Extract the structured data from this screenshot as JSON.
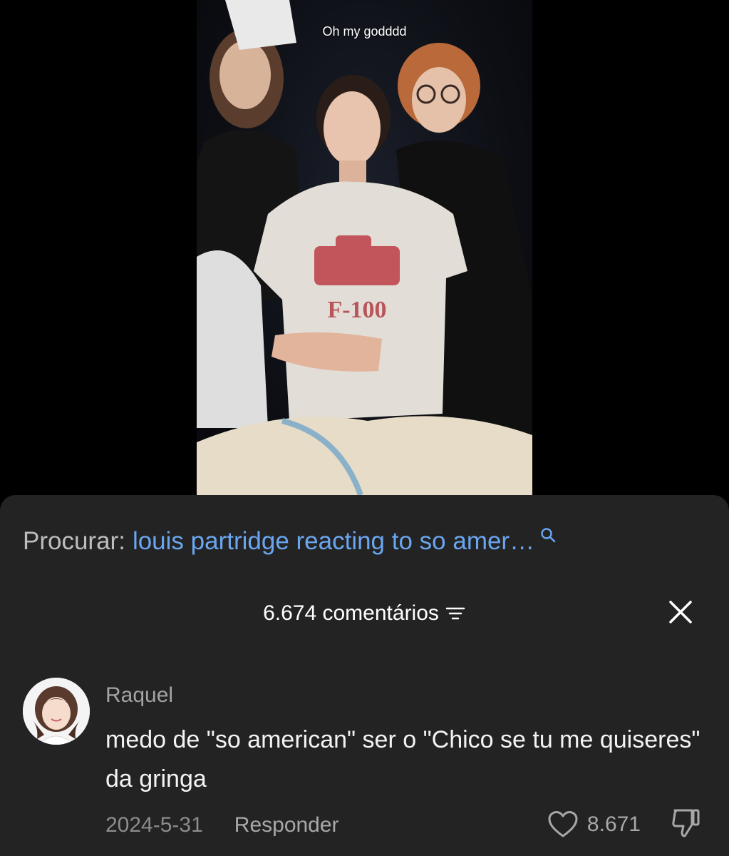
{
  "video": {
    "caption": "Oh my godddd",
    "shirt_print": "F-100"
  },
  "search": {
    "prefix": "Procurar:",
    "query": "louis partridge reacting to so amer…"
  },
  "comments_header": {
    "count_label": "6.674 comentários"
  },
  "comment": {
    "username": "Raquel",
    "text": "medo de \"so american\" ser o \"Chico se tu me quiseres\" da gringa",
    "date": "2024-5-31",
    "reply_label": "Responder",
    "like_count": "8.671"
  },
  "colors": {
    "sheet_bg": "#232323",
    "link_blue": "#6aa6f0",
    "muted_text": "#a8a8a8"
  },
  "icons": [
    "search-icon",
    "filter-icon",
    "close-icon",
    "heart-icon",
    "thumbs-down-icon"
  ]
}
